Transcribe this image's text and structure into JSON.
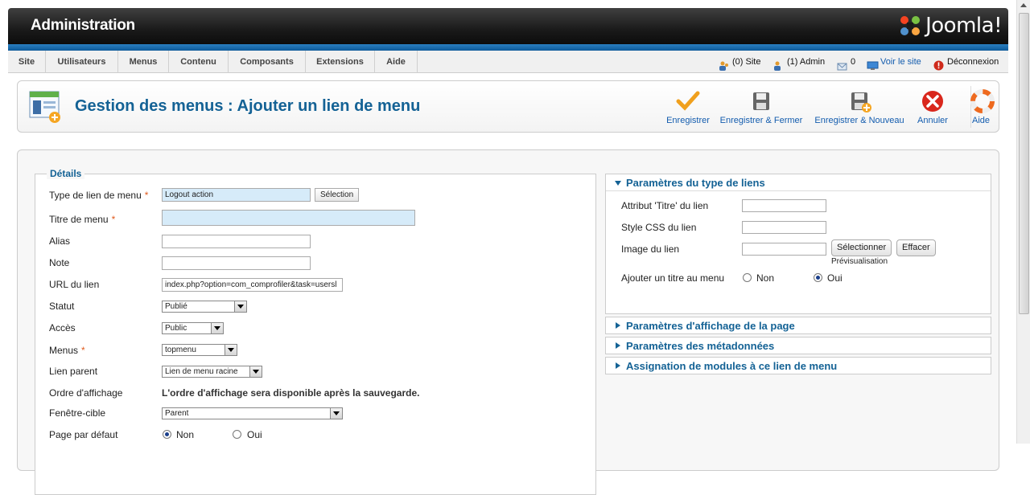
{
  "header": {
    "title": "Administration",
    "logo_text": "Joomla!"
  },
  "menubar": {
    "items": [
      "Site",
      "Utilisateurs",
      "Menus",
      "Contenu",
      "Composants",
      "Extensions",
      "Aide"
    ],
    "status": {
      "site_count": "(0) Site",
      "admin_count": "(1) Admin",
      "messages": "0",
      "view_site": "Voir le site",
      "logout": "Déconnexion"
    }
  },
  "toolbar": {
    "title": "Gestion des menus : Ajouter un lien de menu",
    "buttons": {
      "save": "Enregistrer",
      "save_close": "Enregistrer & Fermer",
      "save_new": "Enregistrer & Nouveau",
      "cancel": "Annuler",
      "help": "Aide"
    }
  },
  "details": {
    "legend": "Détails",
    "required_mark": "*",
    "menu_type_label": "Type de lien de menu",
    "menu_type_value": "Logout action",
    "select_button": "Sélection",
    "menu_title_label": "Titre de menu",
    "menu_title_value": "",
    "alias_label": "Alias",
    "alias_value": "",
    "note_label": "Note",
    "note_value": "",
    "url_label": "URL du lien",
    "url_value": "index.php?option=com_comprofiler&task=usersl",
    "status_label": "Statut",
    "status_value": "Publié",
    "access_label": "Accès",
    "access_value": "Public",
    "menus_label": "Menus",
    "menus_value": "topmenu",
    "parent_label": "Lien parent",
    "parent_value": "Lien de menu racine",
    "order_label": "Ordre d'affichage",
    "order_note": "L'ordre d'affichage sera disponible après la sauvegarde.",
    "target_label": "Fenêtre-cible",
    "target_value": "Parent",
    "default_label": "Page par défaut",
    "no": "Non",
    "yes": "Oui"
  },
  "link_params": {
    "title": "Paramètres du type de liens",
    "title_attr_label": "Attribut 'Titre' du lien",
    "css_label": "Style CSS du lien",
    "image_label": "Image du lien",
    "select_button": "Sélectionner",
    "clear_button": "Effacer",
    "preview": "Prévisualisation",
    "add_title_label": "Ajouter un titre au menu",
    "no": "Non",
    "yes": "Oui"
  },
  "collapsed_panels": [
    "Paramètres d'affichage de la page",
    "Paramètres des métadonnées",
    "Assignation de modules à ce lien de menu"
  ]
}
